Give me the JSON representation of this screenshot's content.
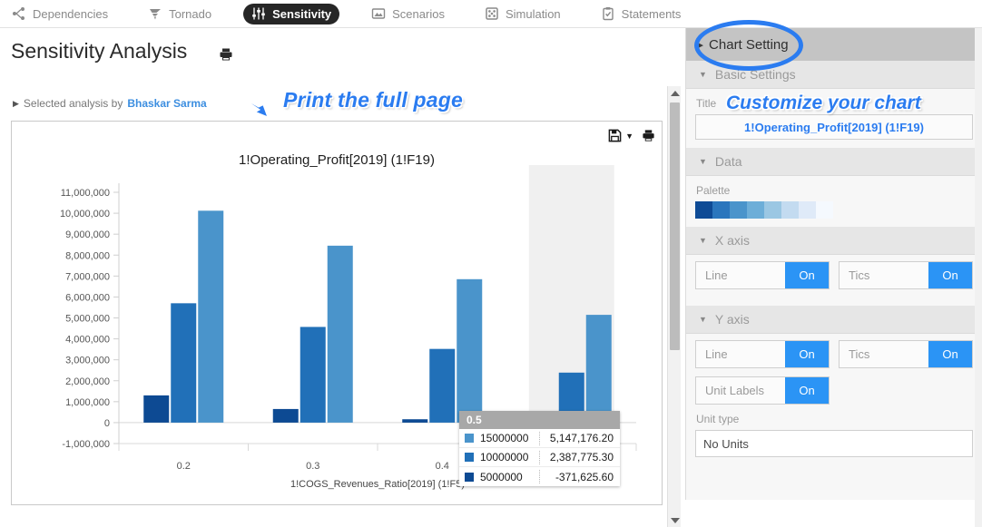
{
  "nav": {
    "tabs": [
      {
        "label": "Dependencies",
        "icon": "dependencies-icon",
        "active": false
      },
      {
        "label": "Tornado",
        "icon": "tornado-icon",
        "active": false
      },
      {
        "label": "Sensitivity",
        "icon": "sliders-icon",
        "active": true
      },
      {
        "label": "Scenarios",
        "icon": "image-icon",
        "active": false
      },
      {
        "label": "Simulation",
        "icon": "dice-icon",
        "active": false
      },
      {
        "label": "Statements",
        "icon": "clipboard-check-icon",
        "active": false
      }
    ]
  },
  "page": {
    "title": "Sensitivity Analysis",
    "subtitle_prefix": "Selected analysis by",
    "subtitle_author": "Bhaskar Sarma",
    "print_icon": "printer-icon"
  },
  "annotations": {
    "print_full_page": "Print the full page",
    "customize_chart": "Customize your chart",
    "accent_color": "#2b7cf0"
  },
  "chart_card": {
    "save_icon": "floppy-disk-icon",
    "save_caret": "▼",
    "print_icon": "printer-icon"
  },
  "chart_data": {
    "type": "bar",
    "title": "1!Operating_Profit[2019] (1!F19)",
    "xlabel": "1!COGS_Revenues_Ratio[2019] (1!F5)",
    "ylabel": "",
    "categories": [
      "0.2",
      "0.3",
      "0.4",
      "0.5"
    ],
    "series": [
      {
        "name": "5000000",
        "color": "#0d4a93",
        "values": [
          1300000,
          650000,
          160000,
          -371625.6
        ]
      },
      {
        "name": "10000000",
        "color": "#2170b8",
        "values": [
          5700000,
          4570000,
          3520000,
          2387775.3
        ]
      },
      {
        "name": "15000000",
        "color": "#4a94cb",
        "values": [
          10120000,
          8450000,
          6850000,
          5147176.2
        ]
      }
    ],
    "ylim": [
      -1000000,
      11000000
    ],
    "ytick_labels": [
      "11,000,000",
      "10,000,000",
      "9,000,000",
      "8,000,000",
      "7,000,000",
      "6,000,000",
      "5,000,000",
      "4,000,000",
      "3,000,000",
      "2,000,000",
      "1,000,000",
      "0",
      "-1,000,000"
    ],
    "ytick_values": [
      11000000,
      10000000,
      9000000,
      8000000,
      7000000,
      6000000,
      5000000,
      4000000,
      3000000,
      2000000,
      1000000,
      0,
      -1000000
    ],
    "grid": false,
    "legend": "none",
    "highlighted_category": "0.5"
  },
  "tooltip": {
    "header": "0.5",
    "rows": [
      {
        "swatch": "#4a94cb",
        "name": "15000000",
        "value": "5,147,176.20"
      },
      {
        "swatch": "#2170b8",
        "name": "10000000",
        "value": "2,387,775.30"
      },
      {
        "swatch": "#0d4a93",
        "name": "5000000",
        "value": "-371,625.60"
      }
    ]
  },
  "sidebar": {
    "panel_title": "Chart Setting",
    "collapse_glyph": "▸▸",
    "sections": {
      "basic": {
        "label": "Basic Settings",
        "caret": "▼"
      },
      "data": {
        "label": "Data",
        "caret": "▼"
      },
      "xaxis": {
        "label": "X axis",
        "caret": "▼"
      },
      "yaxis": {
        "label": "Y axis",
        "caret": "▼"
      }
    },
    "title_field": {
      "label": "Title",
      "value": "1!Operating_Profit[2019] (1!F19)"
    },
    "palette": {
      "label": "Palette",
      "swatches": [
        "#0e4b96",
        "#2a76bd",
        "#4a94cb",
        "#6daed8",
        "#9bc7e3",
        "#c3dbf0",
        "#dfeaf8",
        "#f5f9fe"
      ]
    },
    "xaxis_controls": [
      {
        "label": "Line",
        "state": "On"
      },
      {
        "label": "Tics",
        "state": "On"
      }
    ],
    "yaxis_controls": [
      {
        "label": "Line",
        "state": "On"
      },
      {
        "label": "Tics",
        "state": "On"
      }
    ],
    "unit_labels": {
      "label": "Unit Labels",
      "state": "On"
    },
    "unit_type": {
      "label": "Unit type",
      "value": "No Units"
    }
  }
}
